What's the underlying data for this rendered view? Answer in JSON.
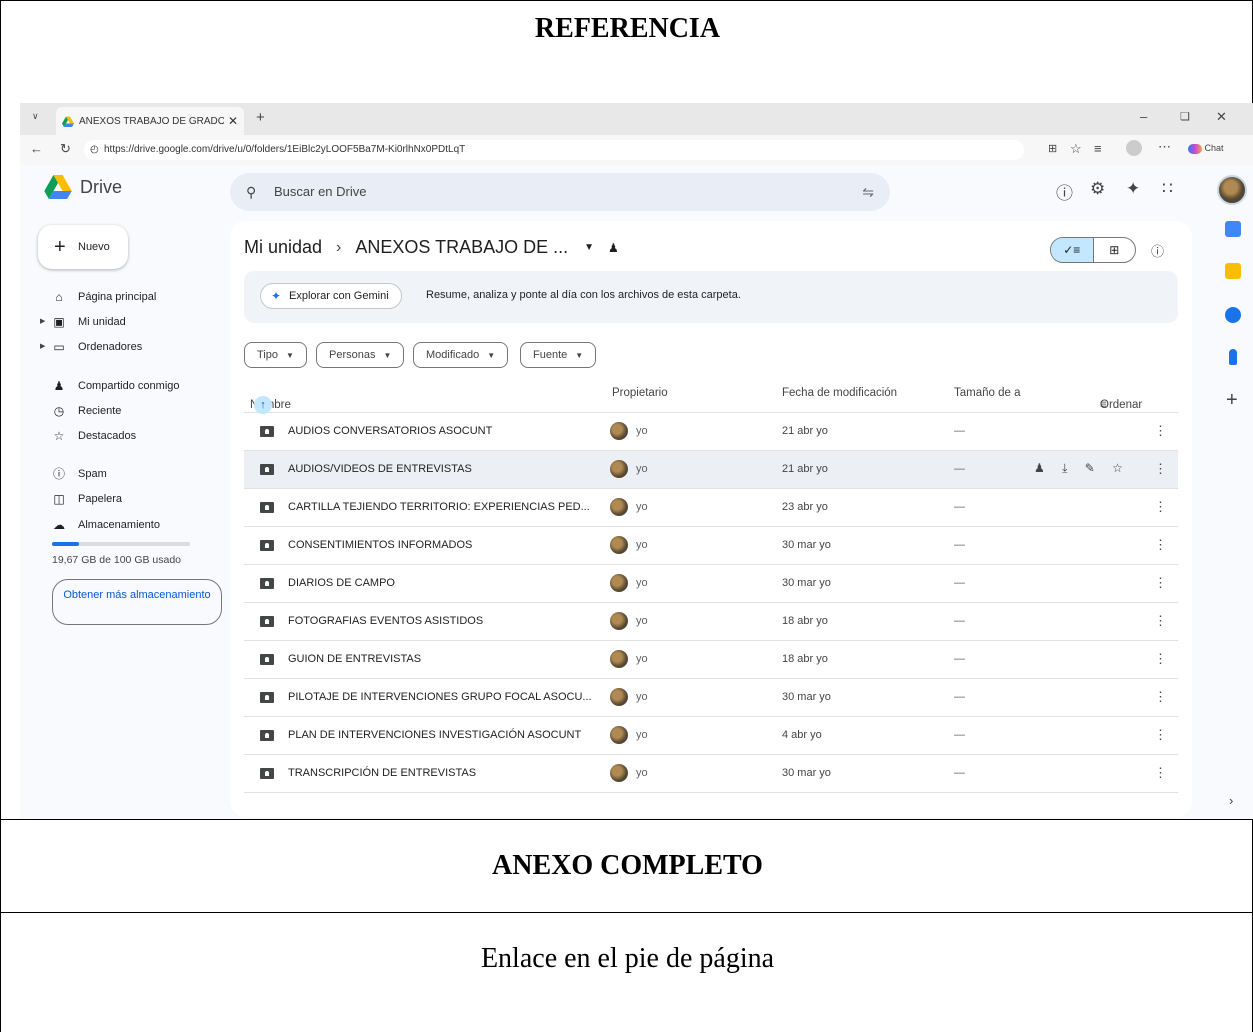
{
  "document": {
    "reference_heading": "REFERENCIA",
    "annex_heading": "ANEXO COMPLETO",
    "footer_text": "Enlace en el pie de página"
  },
  "browser": {
    "tab_title": "ANEXOS TRABAJO DE GRADO SA",
    "url": "https://drive.google.com/drive/u/0/folders/1EiBlc2yLOOF5Ba7M-Ki0rlhNx0PDtLqT",
    "chat_label": "Chat"
  },
  "drive": {
    "app_name": "Drive",
    "search_placeholder": "Buscar en Drive",
    "new_button": "Nuevo",
    "nav": [
      {
        "label": "Página principal",
        "icon": "home-icon"
      },
      {
        "label": "Mi unidad",
        "icon": "my-drive-icon"
      },
      {
        "label": "Ordenadores",
        "icon": "computer-icon"
      },
      {
        "label": "Compartido conmigo",
        "icon": "shared-icon"
      },
      {
        "label": "Reciente",
        "icon": "clock-icon"
      },
      {
        "label": "Destacados",
        "icon": "star-icon"
      },
      {
        "label": "Spam",
        "icon": "spam-icon"
      },
      {
        "label": "Papelera",
        "icon": "trash-icon"
      },
      {
        "label": "Almacenamiento",
        "icon": "cloud-icon"
      }
    ],
    "storage": {
      "text": "19,67 GB de 100 GB usado",
      "used_fraction": 0.1967
    },
    "get_more": "Obtener más almacenamiento",
    "breadcrumb": {
      "root": "Mi unidad",
      "current": "ANEXOS TRABAJO DE ..."
    },
    "gemini": {
      "button": "Explorar con Gemini",
      "text": "Resume, analiza y ponte al día con los archivos de esta carpeta."
    },
    "filters": [
      "Tipo",
      "Personas",
      "Modificado",
      "Fuente"
    ],
    "columns": {
      "name": "Nombre",
      "owner": "Propietario",
      "modified": "Fecha de modificación",
      "size": "Tamaño de a",
      "sort": "Ordenar"
    },
    "files": [
      {
        "name": "AUDIOS CONVERSATORIOS ASOCUNT",
        "owner": "yo",
        "modified": "21 abr yo",
        "size": "—"
      },
      {
        "name": "AUDIOS/VIDEOS DE ENTREVISTAS",
        "owner": "yo",
        "modified": "21 abr yo",
        "size": "—"
      },
      {
        "name": "CARTILLA TEJIENDO TERRITORIO: EXPERIENCIAS PED...",
        "owner": "yo",
        "modified": "23 abr yo",
        "size": "—"
      },
      {
        "name": "CONSENTIMIENTOS INFORMADOS",
        "owner": "yo",
        "modified": "30 mar yo",
        "size": "—"
      },
      {
        "name": "DIARIOS DE CAMPO",
        "owner": "yo",
        "modified": "30 mar yo",
        "size": "—"
      },
      {
        "name": "FOTOGRAFIAS EVENTOS ASISTIDOS",
        "owner": "yo",
        "modified": "18 abr yo",
        "size": "—"
      },
      {
        "name": "GUION DE ENTREVISTAS",
        "owner": "yo",
        "modified": "18 abr yo",
        "size": "—"
      },
      {
        "name": "PILOTAJE DE INTERVENCIONES GRUPO FOCAL ASOCU...",
        "owner": "yo",
        "modified": "30 mar yo",
        "size": "—"
      },
      {
        "name": "PLAN DE INTERVENCIONES INVESTIGACIÓN ASOCUNT",
        "owner": "yo",
        "modified": "4 abr yo",
        "size": "—"
      },
      {
        "name": "TRANSCRIPCIÓN DE ENTREVISTAS",
        "owner": "yo",
        "modified": "30 mar yo",
        "size": "—"
      }
    ],
    "colors": {
      "accent": "#0b57d0",
      "selected": "#c2e7ff",
      "surface": "#f8fafd"
    }
  }
}
